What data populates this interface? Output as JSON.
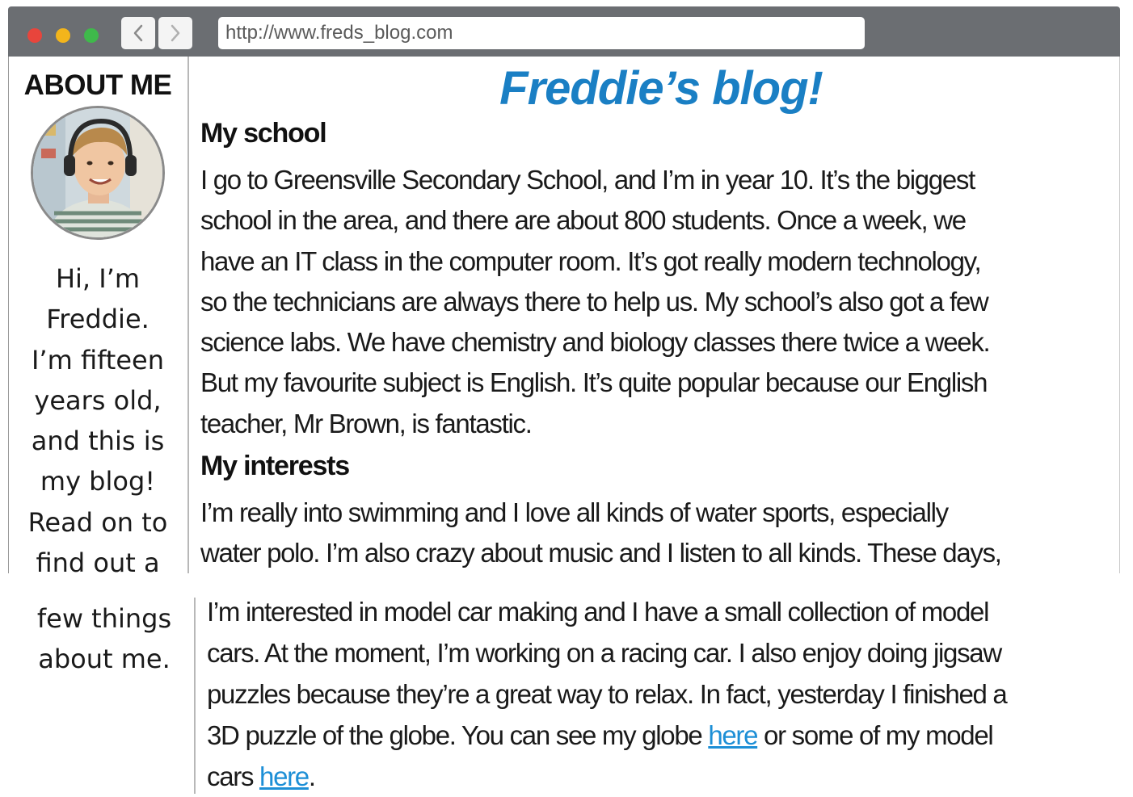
{
  "browser": {
    "url": "http://www.freds_blog.com",
    "back_icon": "chevron-left-icon",
    "forward_icon": "chevron-right-icon"
  },
  "sidebar": {
    "title": "ABOUT ME",
    "bio_lines_top": [
      "Hi, I’m",
      "Freddie.",
      "I’m fifteen",
      "years old,",
      "and this is",
      "my blog!",
      "Read on to",
      "find out a"
    ],
    "bio_lines_bottom": [
      "few things",
      "about me."
    ]
  },
  "main": {
    "title": "Freddie’s blog!",
    "sections": [
      {
        "heading": "My school",
        "lines": [
          "I go to Greensville Secondary School, and I’m in year 10. It’s the biggest",
          "school in the area, and there are about 800 students. Once a week, we",
          "have an IT class in the computer room. It’s got really modern technology,",
          "so the technicians are always there to help us. My school’s also got a few",
          "science labs. We have chemistry and biology classes there twice a week.",
          "But my favourite subject is English. It’s quite popular because our English",
          "teacher, Mr Brown, is fantastic."
        ]
      },
      {
        "heading": "My interests",
        "lines_top": [
          "I’m really into swimming and I love all kinds of water sports, especially",
          "water polo. I’m also crazy about music and I listen to all kinds. These days,"
        ],
        "lines_bottom": [
          "I’m interested in model car making and I have a small collection of model",
          "cars. At the moment, I’m working on a racing car. I also enjoy doing jigsaw",
          "puzzles because they’re a great way to relax. In fact, yesterday I finished a"
        ],
        "line_globe_before": "3D puzzle of the globe. You can see my globe ",
        "line_globe_link": "here",
        "line_globe_after": " or some of my model",
        "line_cars_before": "cars ",
        "line_cars_link": "here",
        "line_cars_after": "."
      }
    ]
  },
  "colors": {
    "title_blue": "#1a7fc4",
    "link_blue": "#1d8fd6",
    "chrome_gray": "#6b6e72"
  }
}
